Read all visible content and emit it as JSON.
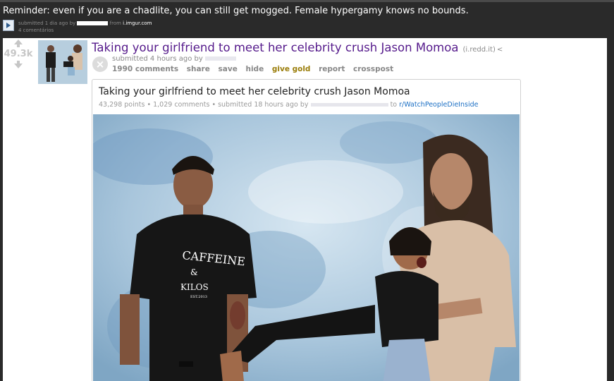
{
  "outer": {
    "title": "Reminder: even if you are a chadlite, you can still get mogged. Female hypergamy knows no bounds.",
    "submitted_prefix": "submitted 1 dia ago by",
    "submitted_from": "from",
    "domain": "i.imgur.com",
    "comments": "4 comentários"
  },
  "post": {
    "score": "49.3k",
    "title": "Taking your girlfriend to meet her celebrity crush Jason Momoa",
    "domain": "(i.redd.it)",
    "submitted": "submitted 4 hours ago by",
    "buttons": {
      "comments": "1990 comments",
      "share": "share",
      "save": "save",
      "hide": "hide",
      "give_gold": "give gold",
      "report": "report",
      "crosspost": "crosspost"
    }
  },
  "card": {
    "title": "Taking your girlfriend to meet her celebrity crush Jason Momoa",
    "points": "43,298 points",
    "comments": "1,029 comments",
    "submitted": "submitted 18 hours ago by",
    "to": "to",
    "subreddit": "r/WatchPeopleDieInside"
  },
  "shirt": {
    "line1": "CAFFEINE",
    "mark": "&",
    "line2": "KILOS",
    "line3": "EST.2013"
  },
  "colors": {
    "visited_link": "#551a8b",
    "gold": "#9a7d0a",
    "subreddit_link": "#1b6fc4",
    "backdrop": "#a9c6dc"
  },
  "icons": [
    "upvote-icon",
    "downvote-icon",
    "close-icon",
    "share-icon",
    "link-thumbnail-icon"
  ]
}
